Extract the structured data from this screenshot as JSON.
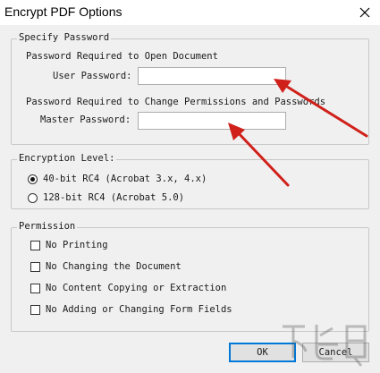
{
  "window": {
    "title": "Encrypt PDF Options"
  },
  "password_group": {
    "legend": "Specify Password",
    "open_heading": "Password Required to Open Document",
    "user_label": "User Password:",
    "user_value": "",
    "perm_heading": "Password Required to Change Permissions and Passwords",
    "master_label": "Master Password:",
    "master_value": ""
  },
  "encryption_group": {
    "legend": "Encryption Level:",
    "options": [
      {
        "label": "40-bit RC4 (Acrobat 3.x, 4.x)",
        "selected": true
      },
      {
        "label": "128-bit RC4 (Acrobat 5.0)",
        "selected": false
      }
    ]
  },
  "permission_group": {
    "legend": "Permission",
    "options": [
      {
        "label": "No Printing",
        "checked": false
      },
      {
        "label": "No Changing the Document",
        "checked": false
      },
      {
        "label": "No Content Copying or Extraction",
        "checked": false
      },
      {
        "label": "No Adding or Changing Form Fields",
        "checked": false
      }
    ]
  },
  "buttons": {
    "ok": "OK",
    "cancel": "Cancel"
  },
  "colors": {
    "annotation_arrow": "#d0201a",
    "default_button_border": "#0078d7"
  },
  "icons": {
    "close": "close-icon",
    "watermark": "watermark-logo"
  },
  "watermark": {
    "text": "下载吧"
  }
}
